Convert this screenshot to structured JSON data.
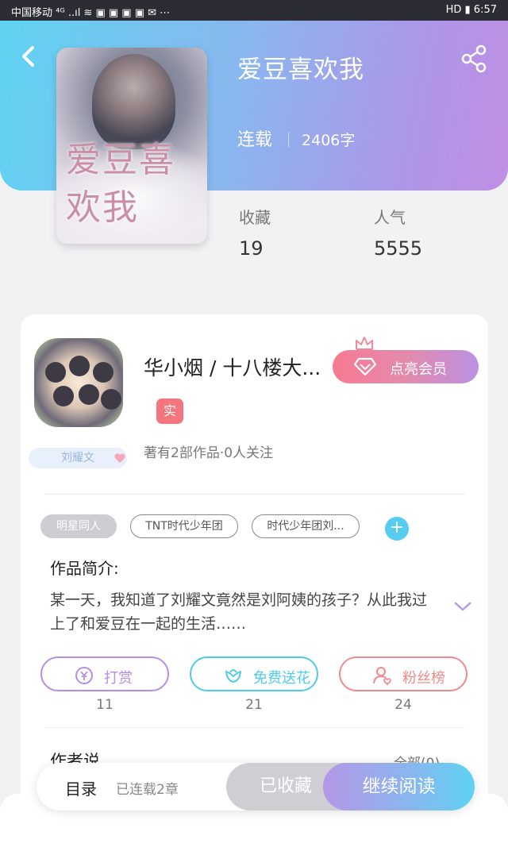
{
  "status_bar": {
    "carrier": "中国移动 ⁴ᴳ ..ıl ≋ ▣ ▣ ▣ ▣ ✉ ⋯",
    "right": "HD ▮ 6:57"
  },
  "book": {
    "title": "爱豆喜欢我",
    "cover_title": "爱豆喜欢我",
    "status": "连载",
    "word_count": "2406字",
    "stats": [
      {
        "label": "收藏",
        "value": "19"
      },
      {
        "label": "人气",
        "value": "5555"
      }
    ]
  },
  "author": {
    "name": "华小烟 / 十八楼大...",
    "vip_label": "点亮会员",
    "verified_label": "实",
    "works_summary": "著有2部作品·0人关注",
    "fan_badge": "刘耀文"
  },
  "tags": [
    "明星同人",
    "TNT时代少年团",
    "时代少年团刘..."
  ],
  "tag_add": "+",
  "intro": {
    "heading": "作品简介:",
    "text": "某一天，我知道了刘耀文竟然是刘阿姨的孩子？从此我过上了和爱豆在一起的生活……"
  },
  "actions": [
    {
      "label": "打赏",
      "count": "11",
      "color": "#b48ee6",
      "icon": "yuan-coin-icon"
    },
    {
      "label": "免费送花",
      "count": "21",
      "color": "#4fcbe9",
      "icon": "flower-icon"
    },
    {
      "label": "粉丝榜",
      "count": "24",
      "color": "#f08a8a",
      "icon": "fan-user-icon"
    }
  ],
  "author_says": {
    "heading": "作者说",
    "all_link": "全部(0)"
  },
  "bottom_bar": {
    "catalog": "目录",
    "chapters": "已连载2章",
    "collected": "已收藏",
    "continue": "继续阅读"
  },
  "colors": {
    "header_gradient_start": "#5fd3f2",
    "header_gradient_end": "#c08fe4",
    "vip_start": "#f77a8f",
    "vip_end": "#bb91e3",
    "tag_add": "#56cdf0",
    "verified": "#f3757e"
  }
}
